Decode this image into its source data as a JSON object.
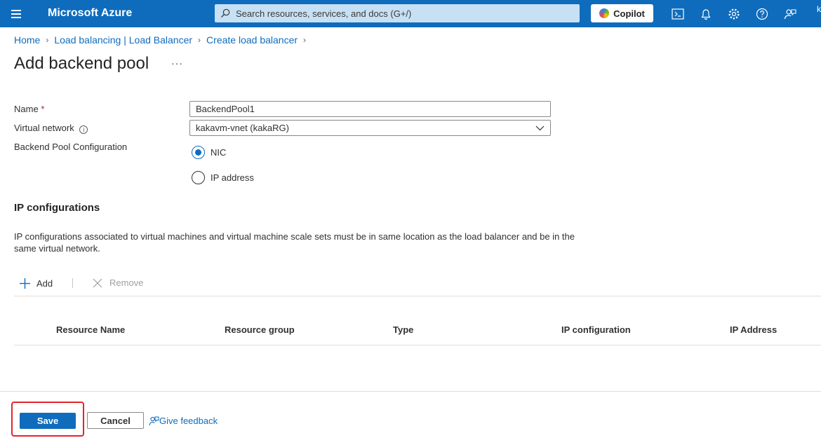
{
  "topbar": {
    "brand": "Microsoft Azure",
    "search_placeholder": "Search resources, services, and docs (G+/)",
    "copilot_label": "Copilot",
    "user_initial": "k"
  },
  "breadcrumb": [
    "Home",
    "Load balancing | Load Balancer",
    "Create load balancer"
  ],
  "page": {
    "title": "Add backend pool",
    "more": "···"
  },
  "form": {
    "name_label": "Name",
    "required_mark": "*",
    "name_value": "BackendPool1",
    "vnet_label": "Virtual network",
    "vnet_value": "kakavm-vnet (kakaRG)",
    "config_label": "Backend Pool Configuration",
    "options": [
      {
        "label": "NIC",
        "checked": true
      },
      {
        "label": "IP address",
        "checked": false
      }
    ]
  },
  "ipconfig": {
    "title": "IP configurations",
    "description": "IP configurations associated to virtual machines and virtual machine scale sets must be in same location as the load balancer and be in the same virtual network.",
    "add_label": "Add",
    "remove_label": "Remove",
    "columns": [
      "Resource Name",
      "Resource group",
      "Type",
      "IP configuration",
      "IP Address"
    ]
  },
  "footer": {
    "save_label": "Save",
    "cancel_label": "Cancel",
    "feedback_label": "Give feedback"
  },
  "colors": {
    "azure_blue": "#0f6cbd",
    "highlight_red": "#e3242b"
  }
}
